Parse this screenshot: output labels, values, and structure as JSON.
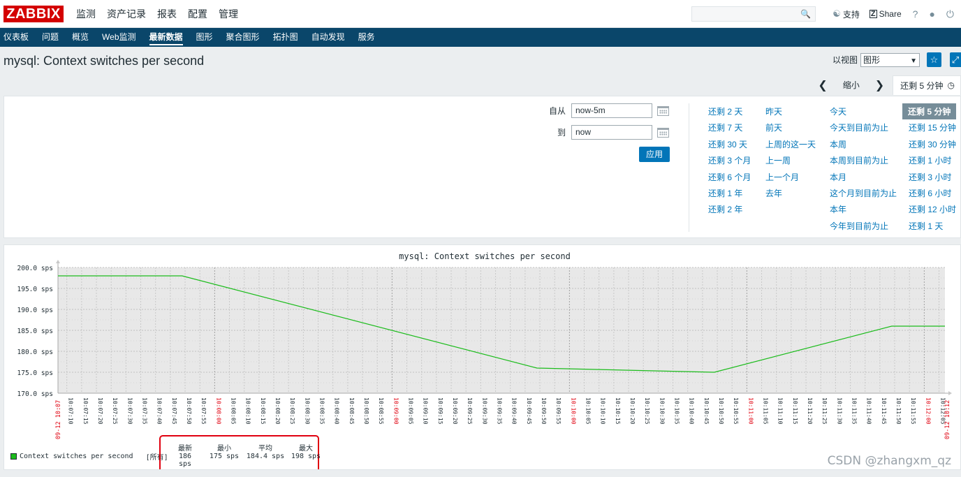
{
  "logo": "ZABBIX",
  "main_menu": [
    "监测",
    "资产记录",
    "报表",
    "配置",
    "管理"
  ],
  "top_right": {
    "support": "支持",
    "share": "Share",
    "help": "?",
    "profile": "user-icon",
    "logout": "power-icon"
  },
  "sub_menu": [
    "仪表板",
    "问题",
    "概览",
    "Web监测",
    "最新数据",
    "图形",
    "聚合图形",
    "拓扑图",
    "自动发现",
    "服务"
  ],
  "active_sub": "最新数据",
  "page_title": "mysql: Context switches per second",
  "view": {
    "label": "以视图",
    "selected": "图形"
  },
  "timenav": {
    "zoom_out": "缩小",
    "current_tab": "还剩 5 分钟"
  },
  "filter": {
    "from_label": "自从",
    "from_value": "now-5m",
    "to_label": "到",
    "to_value": "now",
    "apply": "应用"
  },
  "quick_ranges": {
    "col1": [
      "还剩 2 天",
      "还剩 7 天",
      "还剩 30 天",
      "还剩 3 个月",
      "还剩 6 个月",
      "还剩 1 年",
      "还剩 2 年"
    ],
    "col2": [
      "昨天",
      "前天",
      "上周的这一天",
      "上一周",
      "上一个月",
      "去年"
    ],
    "col3": [
      "今天",
      "今天到目前为止",
      "本周",
      "本周到目前为止",
      "本月",
      "这个月到目前为止",
      "本年",
      "今年到目前为止"
    ],
    "col4": [
      "还剩 5 分钟",
      "还剩 15 分钟",
      "还剩 30 分钟",
      "还剩 1 小时",
      "还剩 3 小时",
      "还剩 6 小时",
      "还剩 12 小时",
      "还剩 1 天"
    ]
  },
  "legend": {
    "series": "Context switches per second",
    "all": "[所有]",
    "headers": [
      "最新",
      "最小",
      "平均",
      "最大"
    ],
    "values": [
      "186 sps",
      "175 sps",
      "184.4 sps",
      "198 sps"
    ]
  },
  "watermark": "CSDN @zhangxm_qz",
  "chart_data": {
    "type": "line",
    "title": "mysql: Context switches per second",
    "ylim": [
      170,
      200
    ],
    "y_ticks": [
      "200.0 sps",
      "195.0 sps",
      "190.0 sps",
      "185.0 sps",
      "180.0 sps",
      "175.0 sps",
      "170.0 sps"
    ],
    "x_ticks": [
      "10:07:10",
      "10:07:15",
      "10:07:20",
      "10:07:25",
      "10:07:30",
      "10:07:35",
      "10:07:40",
      "10:07:45",
      "10:07:50",
      "10:07:55",
      "10:08:00",
      "10:08:05",
      "10:08:10",
      "10:08:15",
      "10:08:20",
      "10:08:25",
      "10:08:30",
      "10:08:35",
      "10:08:40",
      "10:08:45",
      "10:08:50",
      "10:08:55",
      "10:09:00",
      "10:09:05",
      "10:09:10",
      "10:09:15",
      "10:09:20",
      "10:09:25",
      "10:09:30",
      "10:09:35",
      "10:09:40",
      "10:09:45",
      "10:09:50",
      "10:09:55",
      "10:10:00",
      "10:10:05",
      "10:10:10",
      "10:10:15",
      "10:10:20",
      "10:10:25",
      "10:10:30",
      "10:10:35",
      "10:10:40",
      "10:10:45",
      "10:10:50",
      "10:10:55",
      "10:11:00",
      "10:11:05",
      "10:11:10",
      "10:11:15",
      "10:11:20",
      "10:11:25",
      "10:11:30",
      "10:11:35",
      "10:11:40",
      "10:11:45",
      "10:11:50",
      "10:11:55",
      "10:12:00",
      "10:12:05"
    ],
    "x_range_labels": [
      "09-12 10:07",
      "09-12 10:12"
    ],
    "series": [
      {
        "name": "Context switches per second",
        "color": "#1cbc1c",
        "x": [
          "10:07:07",
          "10:07:49",
          "10:09:49",
          "10:10:49",
          "10:11:49",
          "10:12:07"
        ],
        "values": [
          198,
          198,
          176,
          175,
          186,
          186
        ]
      }
    ]
  }
}
